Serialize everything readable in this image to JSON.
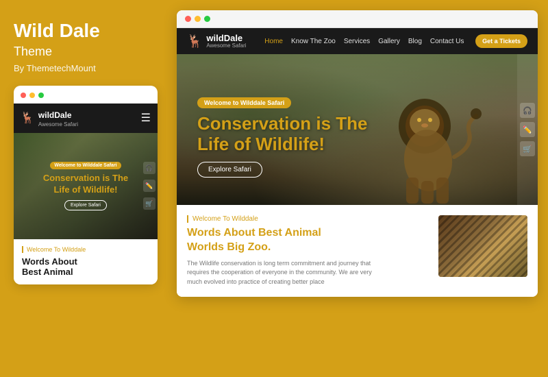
{
  "left": {
    "title": "Wild Dale",
    "subtitle": "Theme",
    "by": "By ThemetechMount",
    "mobile": {
      "logo": "wildDale",
      "logo_sub": "Awesome Safari",
      "badge": "Welcome to Wilddale Safari",
      "hero_line1": "Conservation is The",
      "hero_line2": "Life of ",
      "hero_highlight": "Wildlife!",
      "explore": "Explore Safari",
      "sidebar_icons": [
        "🎧",
        "✏️",
        "🛒"
      ],
      "welcome": "Welcome To Wilddale",
      "words_line1": "Words About",
      "words_line2": "Best Animal"
    }
  },
  "right": {
    "desktop": {
      "logo": "wildDale",
      "logo_sub": "Awesome Safari",
      "nav_links": [
        "Home",
        "Know The Zoo",
        "Services",
        "Gallery",
        "Blog",
        "Contact Us"
      ],
      "ticket_btn": "Get a Tickets",
      "badge": "Welcome to Wilddale Safari",
      "hero_line1": "Conservation is The",
      "hero_line2": "Life of ",
      "hero_highlight": "Wildlife!",
      "explore": "Explore Safari",
      "sidebar_icons": [
        "🎧",
        "✏️",
        "🛒"
      ],
      "welcome": "Welcome To Wilddale",
      "words_title_1": "Words About Best Animal",
      "words_title_2": "Worlds ",
      "words_highlight": "Big Zoo.",
      "words_body": "The Wildlife conservation is long term commitment and journey that requires the cooperation of everyone in the community. We are very much evolved into practice of creating better place"
    }
  },
  "colors": {
    "gold": "#D4A017",
    "dark": "#1a1a1a",
    "white": "#ffffff"
  }
}
